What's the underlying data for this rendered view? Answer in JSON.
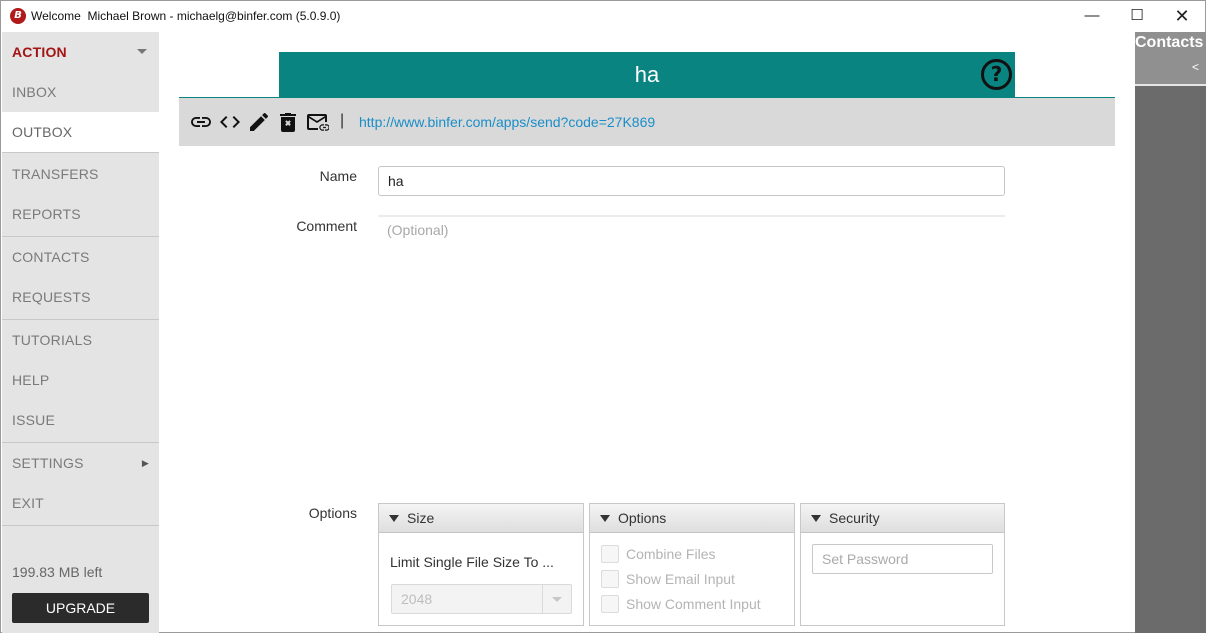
{
  "window": {
    "title": "Welcome  Michael Brown - michaelg@binfer.com (5.0.9.0)",
    "logo_letter": "B",
    "minimize": "—",
    "maximize": "☐",
    "close": "✕"
  },
  "sidebar": {
    "action_label": "ACTION",
    "items": [
      {
        "label": "INBOX"
      },
      {
        "label": "OUTBOX",
        "active": true
      },
      {
        "label": "TRANSFERS"
      },
      {
        "label": "REPORTS"
      },
      {
        "label": "CONTACTS"
      },
      {
        "label": "REQUESTS"
      },
      {
        "label": "TUTORIALS"
      },
      {
        "label": "HELP"
      },
      {
        "label": "ISSUE"
      },
      {
        "label": "SETTINGS"
      },
      {
        "label": "EXIT"
      }
    ],
    "settings_arrow": "▶",
    "storage_left": "199.83 MB left",
    "upgrade_label": "UPGRADE"
  },
  "header": {
    "title": "ha",
    "help_glyph": "?"
  },
  "toolbar": {
    "icons": [
      "link-icon",
      "embed-code-icon",
      "edit-pencil-icon",
      "delete-icon",
      "email-link-icon"
    ],
    "separator": "|",
    "share_link": "http://www.binfer.com/apps/send?code=27K869"
  },
  "form": {
    "name_label": "Name",
    "name_value": "ha",
    "comment_label": "Comment",
    "comment_placeholder": "(Optional)",
    "options_label": "Options"
  },
  "panes": {
    "size": {
      "title": "Size",
      "limit_label": "Limit Single File Size To ...",
      "limit_value": "2048"
    },
    "options": {
      "title": "Options",
      "checkboxes": [
        {
          "label": "Combine Files",
          "checked": false
        },
        {
          "label": "Show Email Input",
          "checked": false
        },
        {
          "label": "Show Comment Input",
          "checked": false
        }
      ]
    },
    "security": {
      "title": "Security",
      "password_placeholder": "Set Password"
    }
  },
  "contacts_panel": {
    "title": "Contacts",
    "collapse_glyph": "<"
  },
  "colors": {
    "accent_teal": "#0a8481",
    "action_red": "#a31515",
    "link_blue": "#1a8ec8",
    "sidebar_bg": "#e4e4e4",
    "contacts_bg": "#6b6b6b"
  }
}
